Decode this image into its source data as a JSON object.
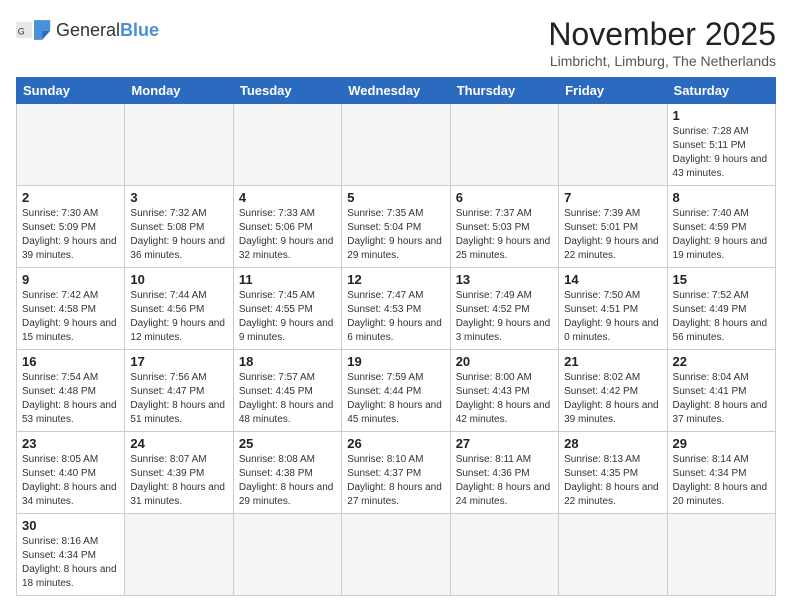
{
  "logo": {
    "text_general": "General",
    "text_blue": "Blue"
  },
  "title": "November 2025",
  "location": "Limbricht, Limburg, The Netherlands",
  "weekdays": [
    "Sunday",
    "Monday",
    "Tuesday",
    "Wednesday",
    "Thursday",
    "Friday",
    "Saturday"
  ],
  "weeks": [
    [
      {
        "day": "",
        "info": ""
      },
      {
        "day": "",
        "info": ""
      },
      {
        "day": "",
        "info": ""
      },
      {
        "day": "",
        "info": ""
      },
      {
        "day": "",
        "info": ""
      },
      {
        "day": "",
        "info": ""
      },
      {
        "day": "1",
        "info": "Sunrise: 7:28 AM\nSunset: 5:11 PM\nDaylight: 9 hours and 43 minutes."
      }
    ],
    [
      {
        "day": "2",
        "info": "Sunrise: 7:30 AM\nSunset: 5:09 PM\nDaylight: 9 hours and 39 minutes."
      },
      {
        "day": "3",
        "info": "Sunrise: 7:32 AM\nSunset: 5:08 PM\nDaylight: 9 hours and 36 minutes."
      },
      {
        "day": "4",
        "info": "Sunrise: 7:33 AM\nSunset: 5:06 PM\nDaylight: 9 hours and 32 minutes."
      },
      {
        "day": "5",
        "info": "Sunrise: 7:35 AM\nSunset: 5:04 PM\nDaylight: 9 hours and 29 minutes."
      },
      {
        "day": "6",
        "info": "Sunrise: 7:37 AM\nSunset: 5:03 PM\nDaylight: 9 hours and 25 minutes."
      },
      {
        "day": "7",
        "info": "Sunrise: 7:39 AM\nSunset: 5:01 PM\nDaylight: 9 hours and 22 minutes."
      },
      {
        "day": "8",
        "info": "Sunrise: 7:40 AM\nSunset: 4:59 PM\nDaylight: 9 hours and 19 minutes."
      }
    ],
    [
      {
        "day": "9",
        "info": "Sunrise: 7:42 AM\nSunset: 4:58 PM\nDaylight: 9 hours and 15 minutes."
      },
      {
        "day": "10",
        "info": "Sunrise: 7:44 AM\nSunset: 4:56 PM\nDaylight: 9 hours and 12 minutes."
      },
      {
        "day": "11",
        "info": "Sunrise: 7:45 AM\nSunset: 4:55 PM\nDaylight: 9 hours and 9 minutes."
      },
      {
        "day": "12",
        "info": "Sunrise: 7:47 AM\nSunset: 4:53 PM\nDaylight: 9 hours and 6 minutes."
      },
      {
        "day": "13",
        "info": "Sunrise: 7:49 AM\nSunset: 4:52 PM\nDaylight: 9 hours and 3 minutes."
      },
      {
        "day": "14",
        "info": "Sunrise: 7:50 AM\nSunset: 4:51 PM\nDaylight: 9 hours and 0 minutes."
      },
      {
        "day": "15",
        "info": "Sunrise: 7:52 AM\nSunset: 4:49 PM\nDaylight: 8 hours and 56 minutes."
      }
    ],
    [
      {
        "day": "16",
        "info": "Sunrise: 7:54 AM\nSunset: 4:48 PM\nDaylight: 8 hours and 53 minutes."
      },
      {
        "day": "17",
        "info": "Sunrise: 7:56 AM\nSunset: 4:47 PM\nDaylight: 8 hours and 51 minutes."
      },
      {
        "day": "18",
        "info": "Sunrise: 7:57 AM\nSunset: 4:45 PM\nDaylight: 8 hours and 48 minutes."
      },
      {
        "day": "19",
        "info": "Sunrise: 7:59 AM\nSunset: 4:44 PM\nDaylight: 8 hours and 45 minutes."
      },
      {
        "day": "20",
        "info": "Sunrise: 8:00 AM\nSunset: 4:43 PM\nDaylight: 8 hours and 42 minutes."
      },
      {
        "day": "21",
        "info": "Sunrise: 8:02 AM\nSunset: 4:42 PM\nDaylight: 8 hours and 39 minutes."
      },
      {
        "day": "22",
        "info": "Sunrise: 8:04 AM\nSunset: 4:41 PM\nDaylight: 8 hours and 37 minutes."
      }
    ],
    [
      {
        "day": "23",
        "info": "Sunrise: 8:05 AM\nSunset: 4:40 PM\nDaylight: 8 hours and 34 minutes."
      },
      {
        "day": "24",
        "info": "Sunrise: 8:07 AM\nSunset: 4:39 PM\nDaylight: 8 hours and 31 minutes."
      },
      {
        "day": "25",
        "info": "Sunrise: 8:08 AM\nSunset: 4:38 PM\nDaylight: 8 hours and 29 minutes."
      },
      {
        "day": "26",
        "info": "Sunrise: 8:10 AM\nSunset: 4:37 PM\nDaylight: 8 hours and 27 minutes."
      },
      {
        "day": "27",
        "info": "Sunrise: 8:11 AM\nSunset: 4:36 PM\nDaylight: 8 hours and 24 minutes."
      },
      {
        "day": "28",
        "info": "Sunrise: 8:13 AM\nSunset: 4:35 PM\nDaylight: 8 hours and 22 minutes."
      },
      {
        "day": "29",
        "info": "Sunrise: 8:14 AM\nSunset: 4:34 PM\nDaylight: 8 hours and 20 minutes."
      }
    ],
    [
      {
        "day": "30",
        "info": "Sunrise: 8:16 AM\nSunset: 4:34 PM\nDaylight: 8 hours and 18 minutes."
      },
      {
        "day": "",
        "info": ""
      },
      {
        "day": "",
        "info": ""
      },
      {
        "day": "",
        "info": ""
      },
      {
        "day": "",
        "info": ""
      },
      {
        "day": "",
        "info": ""
      },
      {
        "day": "",
        "info": ""
      }
    ]
  ]
}
